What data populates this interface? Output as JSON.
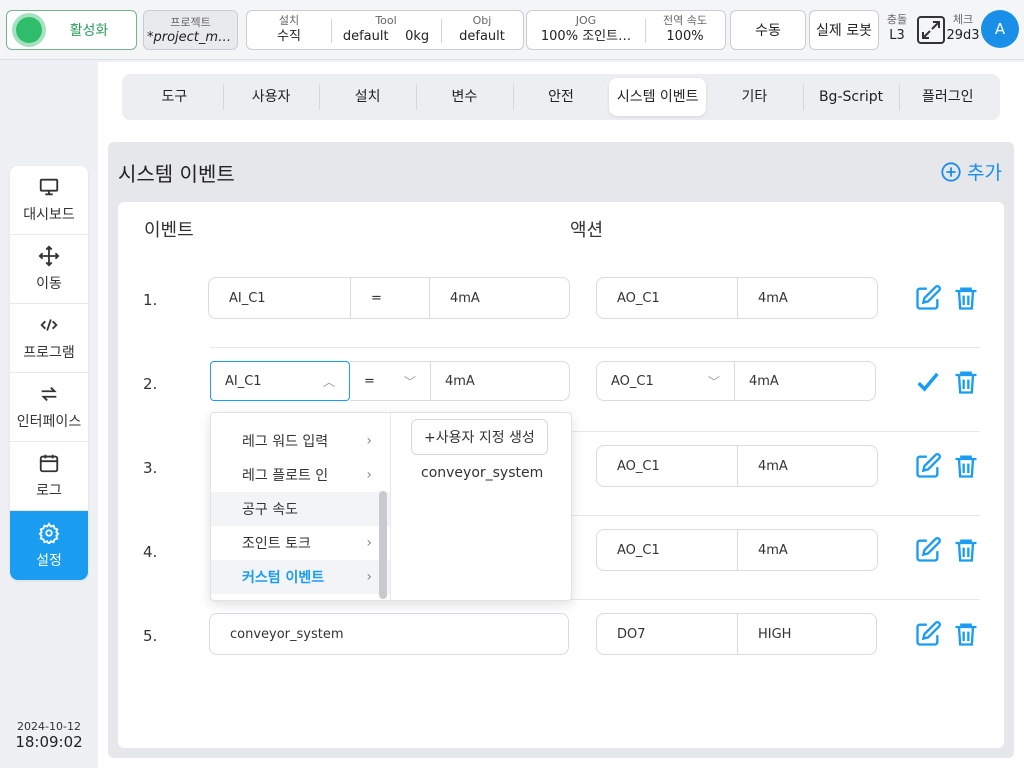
{
  "topbar": {
    "activate_label": "활성화",
    "project_label": "프로젝트",
    "project_value": "*project_mo…",
    "install_label": "설치",
    "install_value": "수직",
    "tool_label": "Tool",
    "tool_value": "default",
    "tool_weight": "0kg",
    "obj_label": "Obj",
    "obj_value": "default",
    "jog_label": "JOG",
    "jog_value": "100%",
    "jog_mode": "조인트…",
    "speed_label": "전역 속도",
    "speed_value": "100%",
    "manual_label": "수동",
    "real_robot_label": "실제 로봇",
    "collision_label": "충돌",
    "collision_value": "L3",
    "check_label": "체크",
    "check_value": "29d3",
    "avatar_letter": "A"
  },
  "sidebar": {
    "items": [
      {
        "label": "대시보드",
        "icon": "monitor-icon"
      },
      {
        "label": "이동",
        "icon": "move-icon"
      },
      {
        "label": "프로그램",
        "icon": "code-icon"
      },
      {
        "label": "인터페이스",
        "icon": "swap-icon"
      },
      {
        "label": "로그",
        "icon": "calendar-icon"
      },
      {
        "label": "설정",
        "icon": "gear-icon"
      }
    ],
    "date": "2024-10-12",
    "time": "18:09:02"
  },
  "tabs": [
    "도구",
    "사용자",
    "설치",
    "변수",
    "안전",
    "시스템 이벤트",
    "기타",
    "Bg-Script",
    "플러그인"
  ],
  "active_tab": "시스템 이벤트",
  "panel": {
    "title": "시스템 이벤트",
    "add_label": "추가",
    "col_event": "이벤트",
    "col_action": "액션"
  },
  "rows": [
    {
      "num": "1.",
      "ev_signal": "AI_C1",
      "ev_op": "=",
      "ev_val": "4mA",
      "act_signal": "AO_C1",
      "act_val": "4mA"
    },
    {
      "num": "2.",
      "ev_signal": "AI_C1",
      "ev_op": "=",
      "ev_val": "4mA",
      "act_signal": "AO_C1",
      "act_val": "4mA"
    },
    {
      "num": "3.",
      "act_signal": "AO_C1",
      "act_val": "4mA"
    },
    {
      "num": "4.",
      "act_signal": "AO_C1",
      "act_val": "4mA"
    },
    {
      "num": "5.",
      "ev_single": "conveyor_system",
      "act_signal": "DO7",
      "act_val": "HIGH"
    }
  ],
  "dropdown": {
    "items": [
      "레그 워드 입력",
      "레그 플로트 인",
      "공구 속도",
      "조인트 토크",
      "커스텀 이벤트"
    ],
    "create_label": "+사용자 지정 생성",
    "options": [
      "conveyor_system"
    ]
  },
  "colors": {
    "accent": "#1a9df0",
    "active_green": "#2fbd6b"
  }
}
